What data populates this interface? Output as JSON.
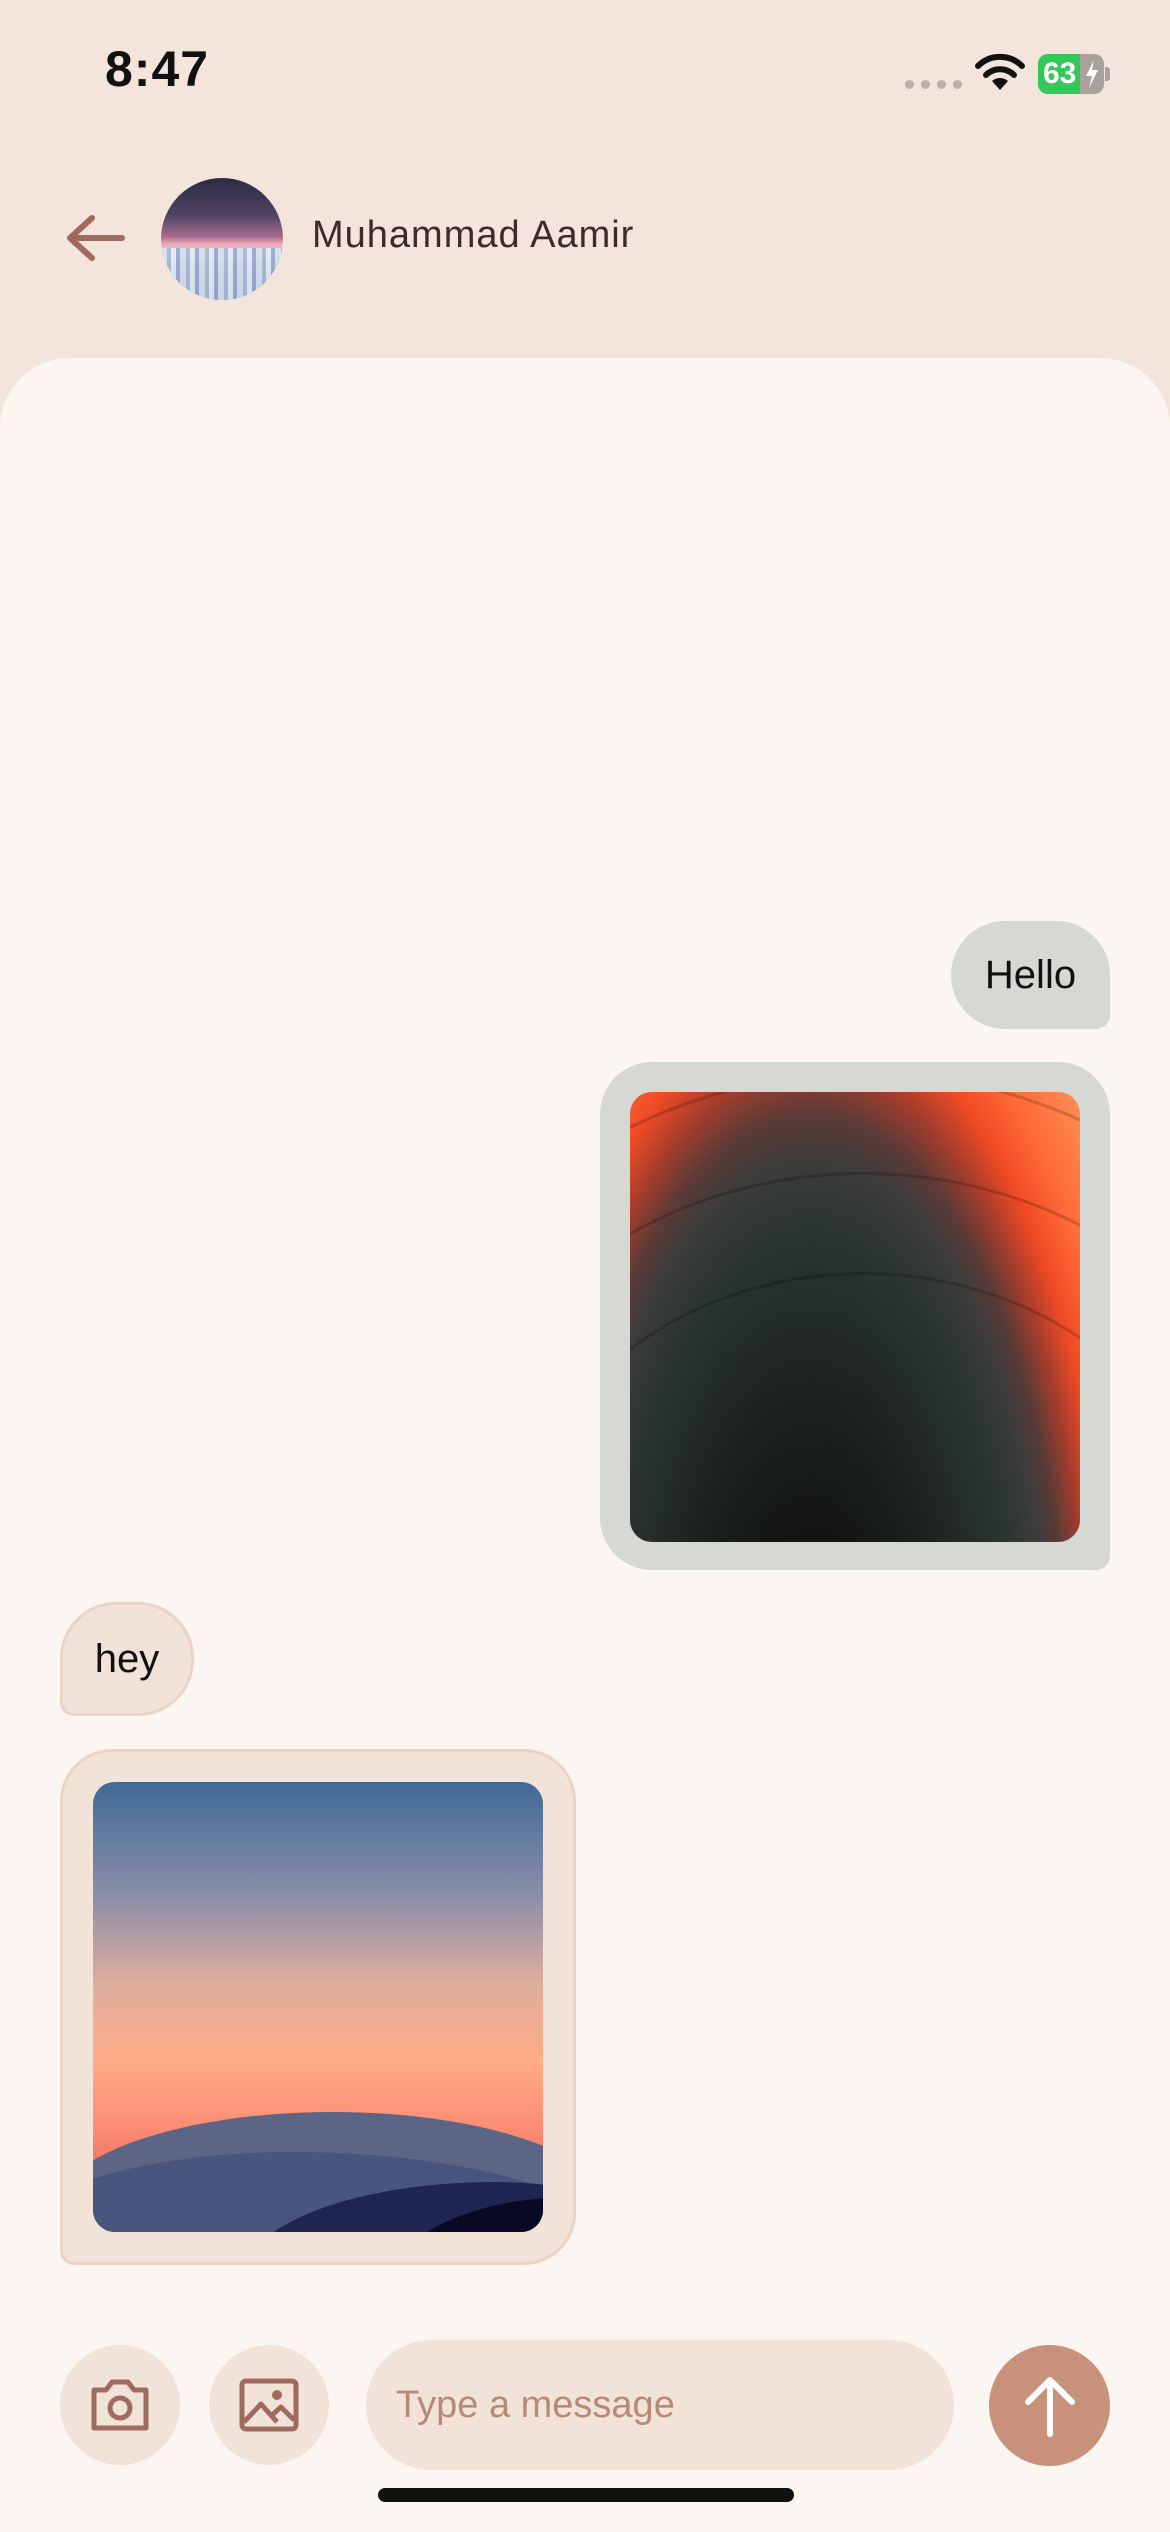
{
  "status_bar": {
    "time": "8:47",
    "battery": "63",
    "battery_fraction": 0.63
  },
  "header": {
    "back_icon": "arrow-left-icon",
    "contact_name": "Muhammad Aamir"
  },
  "messages": [
    {
      "direction": "outgoing",
      "type": "text",
      "text": "Hello"
    },
    {
      "direction": "outgoing",
      "type": "image",
      "image": "abstract-orange-waves"
    },
    {
      "direction": "incoming",
      "type": "text",
      "text": "hey"
    },
    {
      "direction": "incoming",
      "type": "image",
      "image": "sunset-mountains"
    }
  ],
  "composer": {
    "camera_icon": "camera-icon",
    "gallery_icon": "image-icon",
    "placeholder": "Type a message",
    "value": "",
    "send_icon": "arrow-up-icon"
  },
  "colors": {
    "header_bg": "#f3e5db",
    "panel_bg": "#fbf6f2",
    "outgoing_bubble": "#d5d8d3",
    "incoming_bubble": "#f2e3d9",
    "accent": "#c8917b",
    "icon": "#a06a5e"
  }
}
